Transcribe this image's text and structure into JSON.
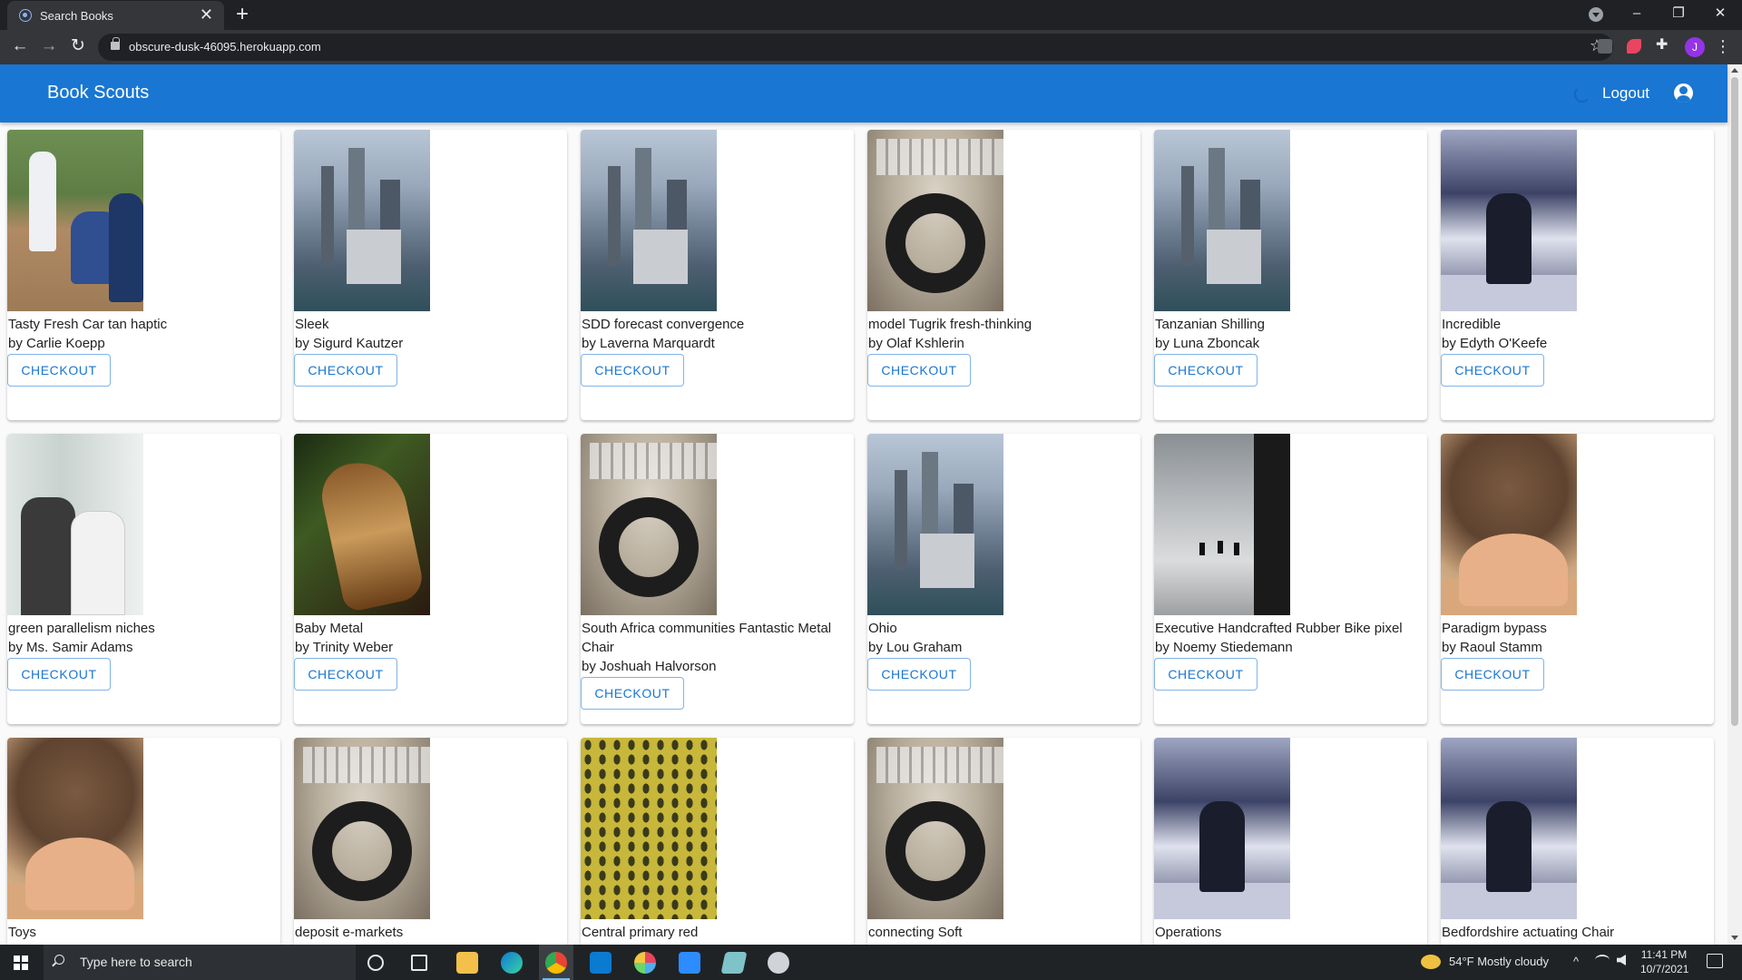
{
  "browser": {
    "tab_title": "Search Books",
    "tab_close": "✕",
    "new_tab": "+",
    "url": "obscure-dusk-46095.herokuapp.com",
    "profile_initial": "J",
    "window_controls": {
      "minimize": "–",
      "restore": "❐",
      "close": "✕"
    },
    "nav": {
      "back": "←",
      "forward": "→",
      "reload": "↻"
    },
    "star": "☆",
    "menu": "⋮"
  },
  "appbar": {
    "brand": "Book Scouts",
    "logout_label": "Logout",
    "primary_color": "#1976d2"
  },
  "books": [
    {
      "title": "Tasty Fresh Car tan haptic",
      "author": "by Carlie Koepp",
      "cover": "baseball",
      "action": "CHECKOUT"
    },
    {
      "title": "Sleek",
      "author": "by Sigurd Kautzer",
      "cover": "city",
      "action": "CHECKOUT"
    },
    {
      "title": "SDD forecast convergence",
      "author": "by Laverna Marquardt",
      "cover": "city",
      "action": "CHECKOUT"
    },
    {
      "title": "model Tugrik fresh-thinking",
      "author": "by Olaf Kshlerin",
      "cover": "headphone",
      "action": "CHECKOUT"
    },
    {
      "title": "Tanzanian Shilling",
      "author": "by Luna Zboncak",
      "cover": "city",
      "action": "CHECKOUT"
    },
    {
      "title": "Incredible",
      "author": "by Edyth O'Keefe",
      "cover": "bar",
      "action": "CHECKOUT"
    },
    {
      "title": "green parallelism niches",
      "author": "by Ms. Samir Adams",
      "cover": "office",
      "action": "CHECKOUT"
    },
    {
      "title": "Baby Metal",
      "author": "by Trinity Weber",
      "cover": "horse",
      "action": "CHECKOUT"
    },
    {
      "title": "South Africa communities Fantastic Metal Chair",
      "author": "by Joshuah Halvorson",
      "cover": "headphone",
      "action": "CHECKOUT"
    },
    {
      "title": "Ohio",
      "author": "by Lou Graham",
      "cover": "city",
      "action": "CHECKOUT"
    },
    {
      "title": "Executive Handcrafted Rubber Bike pixel",
      "author": "by Noemy Stiedemann",
      "cover": "street",
      "action": "CHECKOUT"
    },
    {
      "title": "Paradigm bypass",
      "author": "by Raoul Stamm",
      "cover": "fan",
      "action": "CHECKOUT"
    },
    {
      "title": "Toys",
      "author": "",
      "cover": "fan",
      "action": ""
    },
    {
      "title": "deposit e-markets",
      "author": "",
      "cover": "headphone",
      "action": ""
    },
    {
      "title": "Central primary red",
      "author": "",
      "cover": "yellow",
      "action": ""
    },
    {
      "title": "connecting Soft",
      "author": "",
      "cover": "headphone",
      "action": ""
    },
    {
      "title": "Operations",
      "author": "",
      "cover": "bar",
      "action": ""
    },
    {
      "title": "Bedfordshire actuating Chair",
      "author": "",
      "cover": "bar",
      "action": ""
    }
  ],
  "taskbar": {
    "search_placeholder": "Type here to search",
    "weather": "54°F  Mostly cloudy",
    "time": "11:41 PM",
    "date": "10/7/2021",
    "tray_chevron": "^"
  }
}
